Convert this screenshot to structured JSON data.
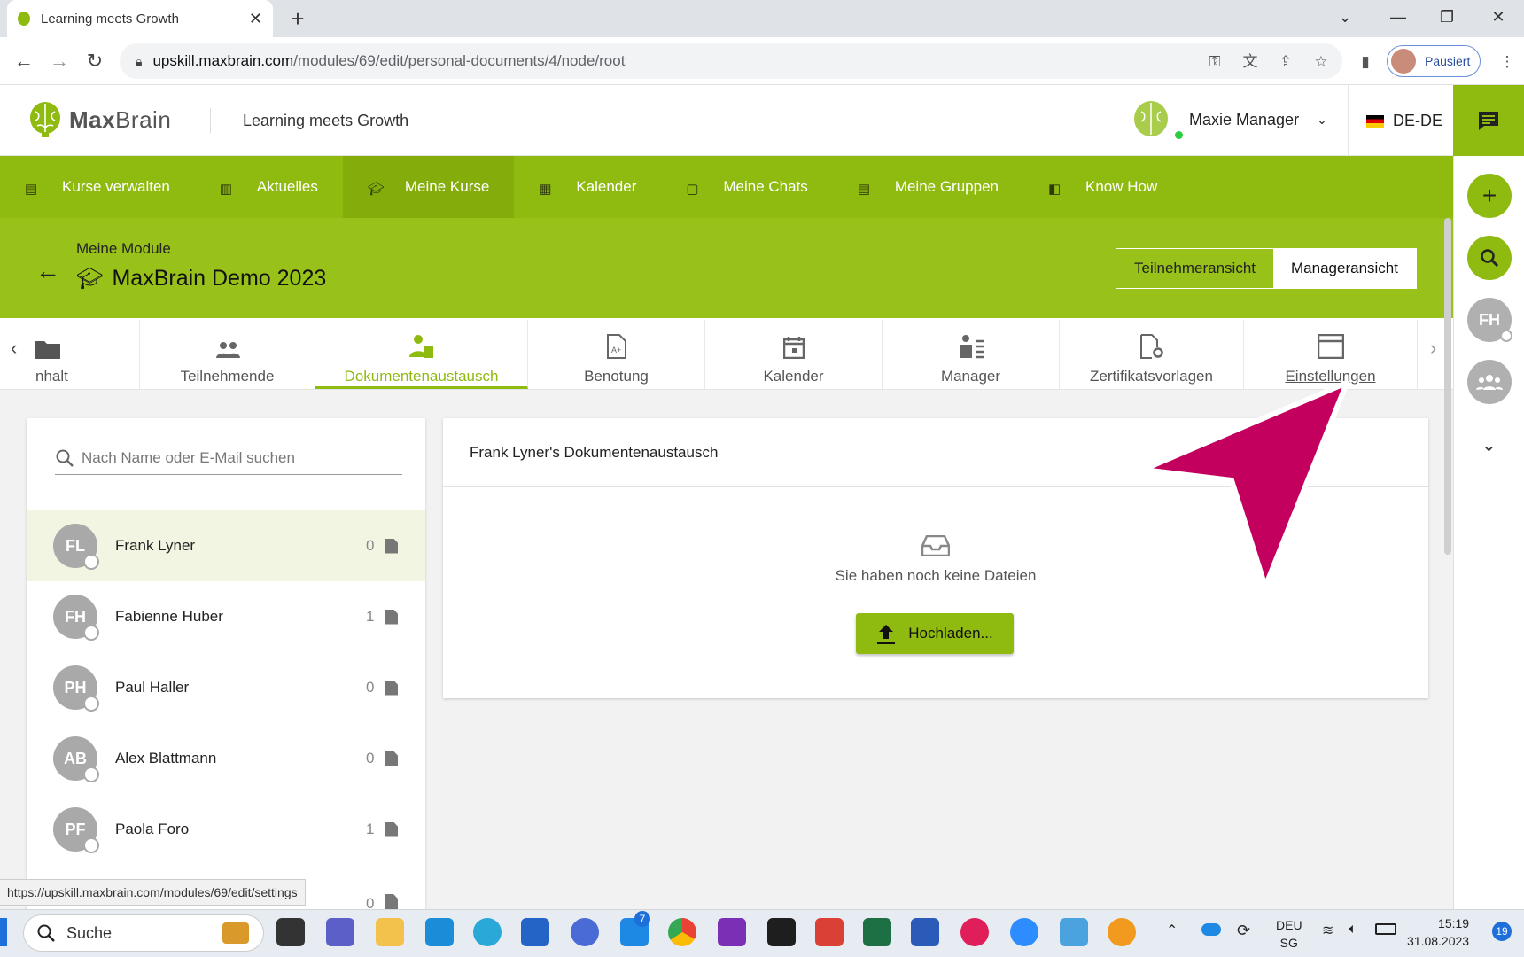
{
  "browser": {
    "tab_title": "Learning meets Growth",
    "url_host": "upskill.maxbrain.com",
    "url_path": "/modules/69/edit/personal-documents/4/node/root",
    "profile_label": "Pausiert",
    "status_url": "https://upskill.maxbrain.com/modules/69/edit/settings"
  },
  "header": {
    "logo_bold": "Max",
    "logo_light": "Brain",
    "tagline": "Learning meets Growth",
    "user_name": "Maxie Manager",
    "language": "DE-DE"
  },
  "mainnav": {
    "items": [
      {
        "label": "Kurse verwalten",
        "icon": "id-card-icon"
      },
      {
        "label": "Aktuelles",
        "icon": "news-icon"
      },
      {
        "label": "Meine Kurse",
        "icon": "graduation-cap-icon"
      },
      {
        "label": "Kalender",
        "icon": "calendar-icon"
      },
      {
        "label": "Meine Chats",
        "icon": "chat-icon"
      },
      {
        "label": "Meine Gruppen",
        "icon": "group-card-icon"
      },
      {
        "label": "Know How",
        "icon": "book-icon"
      }
    ],
    "active_index": 2
  },
  "module": {
    "breadcrumb": "Meine Module",
    "title": "MaxBrain Demo 2023",
    "view_participant": "Teilnehmeransicht",
    "view_manager": "Manageransicht"
  },
  "tabs": [
    {
      "label": "nhalt",
      "icon": "folder-icon"
    },
    {
      "label": "Teilnehmende",
      "icon": "people-icon"
    },
    {
      "label": "Dokumentenaustausch",
      "icon": "person-document-icon"
    },
    {
      "label": "Benotung",
      "icon": "grade-document-icon"
    },
    {
      "label": "Kalender",
      "icon": "calendar-icon"
    },
    {
      "label": "Manager",
      "icon": "manager-icon"
    },
    {
      "label": "Zertifikatsvorlagen",
      "icon": "certificate-settings-icon"
    },
    {
      "label": "Einstellungen",
      "icon": "window-settings-icon"
    }
  ],
  "participants": {
    "search_placeholder": "Nach Name oder E-Mail suchen",
    "rows": [
      {
        "initials": "FL",
        "name": "Frank Lyner",
        "count": "0"
      },
      {
        "initials": "FH",
        "name": "Fabienne Huber",
        "count": "1"
      },
      {
        "initials": "PH",
        "name": "Paul Haller",
        "count": "0"
      },
      {
        "initials": "AB",
        "name": "Alex Blattmann",
        "count": "0"
      },
      {
        "initials": "PF",
        "name": "Paola Foro",
        "count": "1"
      },
      {
        "initials": "",
        "name": "",
        "count": "0"
      }
    ]
  },
  "documents": {
    "title": "Frank Lyner's Dokumentenaustausch",
    "empty_text": "Sie haben noch keine Dateien",
    "upload_label": "Hochladen..."
  },
  "rail": {
    "avatar_initials": "FH"
  },
  "taskbar": {
    "search_label": "Suche",
    "lang_top": "DEU",
    "lang_bottom": "SG",
    "time": "15:19",
    "date": "31.08.2023",
    "notifications": "19",
    "badge_count": "7"
  },
  "colors": {
    "brand_green": "#8fba10",
    "module_header_green": "#98c11a",
    "annotation_pointer": "#c4005f"
  }
}
